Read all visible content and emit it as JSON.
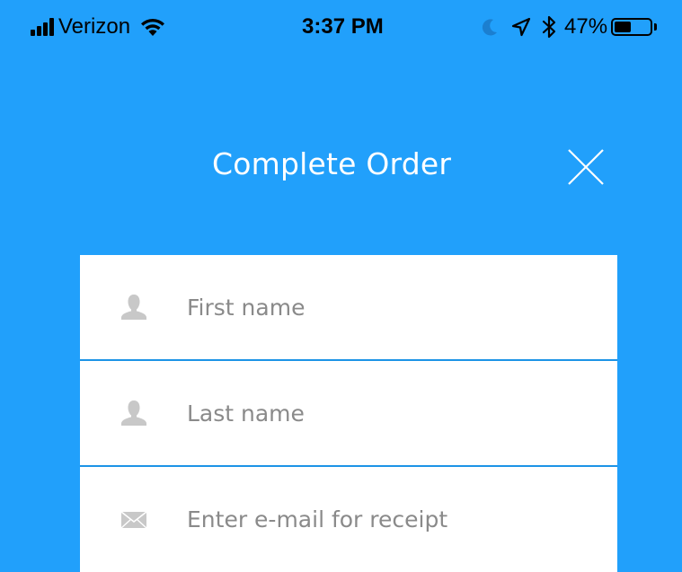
{
  "status_bar": {
    "carrier": "Verizon",
    "time": "3:37 PM",
    "battery_percent": "47%",
    "battery_level": 0.47,
    "icons": [
      "signal-icon",
      "wifi-icon",
      "moon-icon",
      "location-arrow-icon",
      "bluetooth-icon",
      "battery-icon"
    ]
  },
  "header": {
    "title": "Complete Order",
    "close_icon": "close-icon"
  },
  "form": {
    "first_name": {
      "value": "",
      "placeholder": "First name",
      "icon": "person-icon"
    },
    "last_name": {
      "value": "",
      "placeholder": "Last name",
      "icon": "person-icon"
    },
    "email": {
      "value": "",
      "placeholder": "Enter e-mail for receipt",
      "icon": "envelope-icon"
    }
  },
  "colors": {
    "background": "#21a0fb",
    "field_background": "#ffffff",
    "divider": "#1d94e6",
    "placeholder_text": "#8a8a8a",
    "icon_gray": "#c8c8c8",
    "header_text": "#ffffff"
  }
}
